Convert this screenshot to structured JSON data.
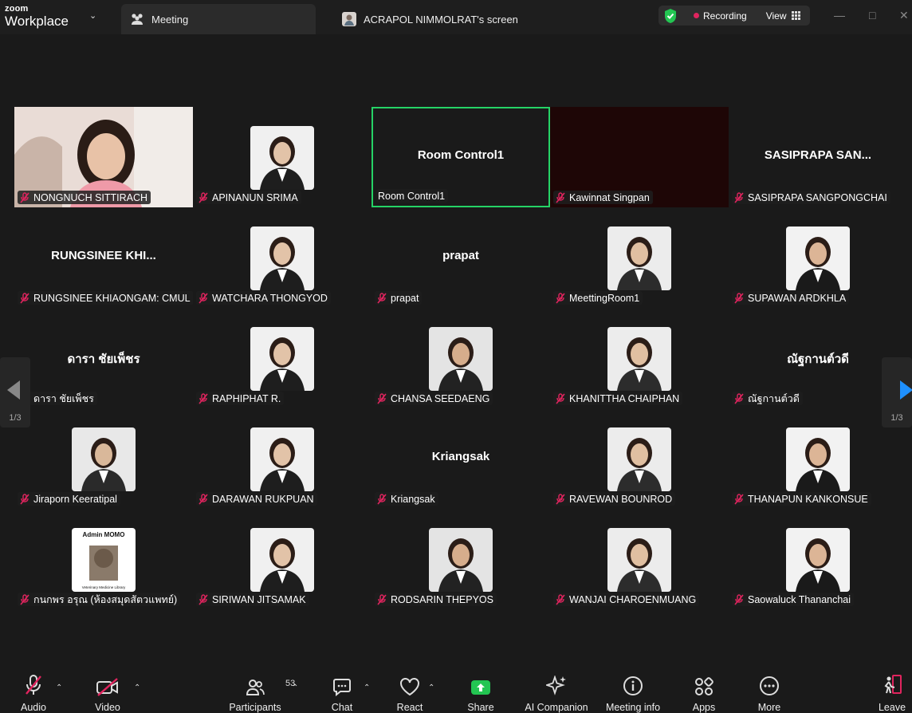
{
  "titlebar": {
    "brand_top": "zoom",
    "brand_bottom": "Workplace",
    "active_tab": "Meeting",
    "screen_tab": "ACRAPOL NIMMOLRAT's screen",
    "recording": "Recording",
    "view": "View",
    "colors": {
      "recording_dot": "#e0245e",
      "shield": "#23c552"
    }
  },
  "gallery": {
    "page_indicator_left": "1/3",
    "page_indicator_right": "1/3",
    "tiles": [
      {
        "label": "NONGNUCH SITTIRACH",
        "type": "video"
      },
      {
        "label": "APINANUN SRIMA",
        "type": "avatar"
      },
      {
        "label": "Room Control1",
        "big_name": "Room Control1",
        "type": "name",
        "active": true
      },
      {
        "label": "Kawinnat Singpan",
        "type": "blank"
      },
      {
        "label": "SASIPRAPA SANGPONGCHAI",
        "big_name": "SASIPRAPA  SAN...",
        "type": "name"
      },
      {
        "label": "RUNGSINEE KHIAONGAM: CMUL",
        "big_name": "RUNGSINEE  KHI...",
        "type": "name"
      },
      {
        "label": "WATCHARA THONGYOD",
        "type": "avatar"
      },
      {
        "label": "prapat",
        "big_name": "prapat",
        "type": "name"
      },
      {
        "label": "MeettingRoom1",
        "type": "avatar"
      },
      {
        "label": "SUPAWAN ARDKHLA",
        "type": "avatar"
      },
      {
        "label": "ดารา ชัยเพ็ชร",
        "big_name": "ดารา ชัยเพ็ชร",
        "type": "name"
      },
      {
        "label": "RAPHIPHAT R.",
        "type": "avatar"
      },
      {
        "label": "CHANSA SEEDAENG",
        "type": "avatar"
      },
      {
        "label": "KHANITTHA CHAIPHAN",
        "type": "avatar"
      },
      {
        "label": "ณัฐกานต์วดี",
        "big_name": "ณัฐกานต์วดี",
        "type": "name"
      },
      {
        "label": "Jiraporn Keeratipal",
        "type": "avatar"
      },
      {
        "label": "DARAWAN RUKPUAN",
        "type": "avatar"
      },
      {
        "label": "Kriangsak",
        "big_name": "Kriangsak",
        "type": "name"
      },
      {
        "label": "RAVEWAN BOUNROD",
        "type": "avatar"
      },
      {
        "label": "THANAPUN KANKONSUE",
        "type": "avatar"
      },
      {
        "label": "กนกพร  อรุณ (ห้องสมุดสัตวแพทย์)",
        "type": "avatar",
        "avatar_title": "Admin MOMO",
        "avatar_sub": "Veterinary Medicine Library"
      },
      {
        "label": "SIRIWAN JITSAMAK",
        "type": "avatar"
      },
      {
        "label": "RODSARIN THEPYOS",
        "type": "avatar"
      },
      {
        "label": "WANJAI CHAROENMUANG",
        "type": "avatar"
      },
      {
        "label": "Saowaluck Thananchai",
        "type": "avatar"
      }
    ]
  },
  "toolbar": {
    "audio": "Audio",
    "video": "Video",
    "participants": "Participants",
    "participants_count": "53",
    "chat": "Chat",
    "react": "React",
    "share": "Share",
    "ai_companion": "AI Companion",
    "meeting_info": "Meeting info",
    "apps": "Apps",
    "more": "More",
    "leave": "Leave",
    "colors": {
      "share": "#23c552",
      "mute": "#e0245e"
    }
  }
}
